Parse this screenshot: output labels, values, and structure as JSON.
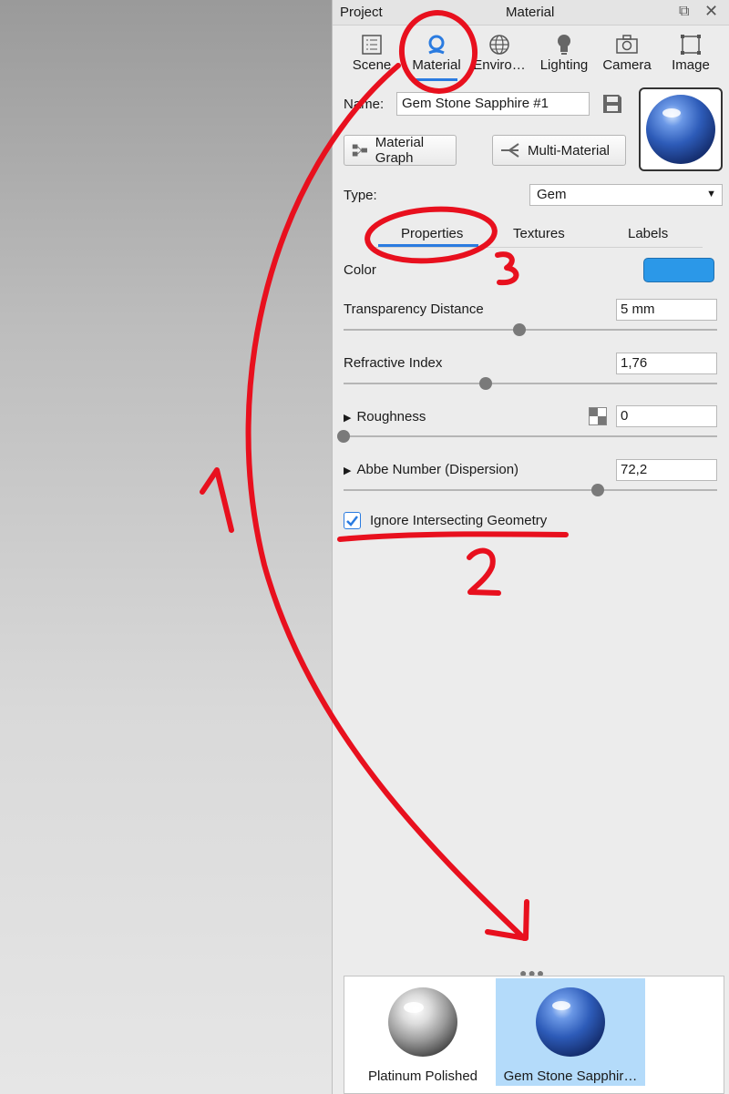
{
  "titlebar": {
    "left_label": "Project",
    "center_label": "Material"
  },
  "tabs": [
    {
      "label": "Scene",
      "icon": "list-icon"
    },
    {
      "label": "Material",
      "icon": "material-icon",
      "active": true
    },
    {
      "label": "Enviro…",
      "icon": "globe-icon"
    },
    {
      "label": "Lighting",
      "icon": "bulb-icon"
    },
    {
      "label": "Camera",
      "icon": "camera-icon"
    },
    {
      "label": "Image",
      "icon": "crop-icon"
    }
  ],
  "material": {
    "name_label": "Name:",
    "name_value": "Gem Stone Sapphire #1",
    "graph_button": "Material Graph",
    "multi_button": "Multi-Material",
    "type_label": "Type:",
    "type_value": "Gem"
  },
  "subtabs": [
    "Properties",
    "Textures",
    "Labels"
  ],
  "properties": {
    "color_label": "Color",
    "color_value": "#2b98e8",
    "transparency_label": "Transparency Distance",
    "transparency_value": "5 mm",
    "transparency_slider": 0.47,
    "refractive_label": "Refractive Index",
    "refractive_value": "1,76",
    "refractive_slider": 0.38,
    "roughness_label": "Roughness",
    "roughness_value": "0",
    "roughness_slider": 0.0,
    "abbe_label": "Abbe Number (Dispersion)",
    "abbe_value": "72,2",
    "abbe_slider": 0.68,
    "ignore_label": "Ignore Intersecting Geometry",
    "ignore_checked": true
  },
  "library": {
    "items": [
      {
        "name": "Platinum Polished",
        "selected": false
      },
      {
        "name": "Gem Stone Sapphir…",
        "selected": true
      }
    ]
  },
  "annotations": {
    "numbers": [
      "1",
      "2",
      "3"
    ],
    "color": "#e8101e"
  }
}
